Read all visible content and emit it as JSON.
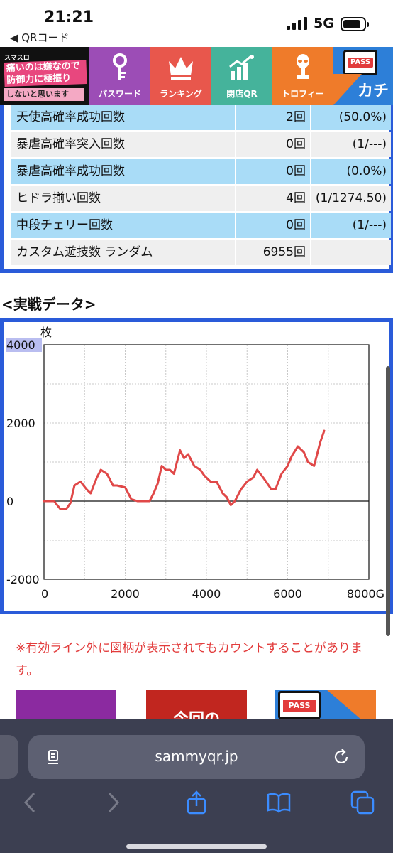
{
  "status_bar": {
    "time": "21:21",
    "back_label": "◀ QRコード",
    "network": "5G"
  },
  "nav": {
    "logo": {
      "line1": "スマスロ",
      "line2": "痛いのは嫌なので防御力に極振りしたいと思います",
      "line3": "しないと思います"
    },
    "tabs": [
      {
        "label": "パスワード",
        "icon": "key-icon",
        "color": "#9c4db6"
      },
      {
        "label": "ランキング",
        "icon": "crown-icon",
        "color": "#e8574c"
      },
      {
        "label": "閉店QR",
        "icon": "growth-chart-icon",
        "color": "#45b39b"
      },
      {
        "label": "トロフィー",
        "icon": "trophy-alien-icon",
        "color": "#ef7b2a"
      }
    ],
    "pass_badge": "PASS",
    "pass_text": "カチ"
  },
  "stats_table": {
    "rows": [
      {
        "label": "天使高確率成功回数",
        "count": "2回",
        "ratio": "(50.0%)",
        "style": "blue"
      },
      {
        "label": "暴虐高確率突入回数",
        "count": "0回",
        "ratio": "(1/---)",
        "style": "gray"
      },
      {
        "label": "暴虐高確率成功回数",
        "count": "0回",
        "ratio": "(0.0%)",
        "style": "blue"
      },
      {
        "label": "ヒドラ揃い回数",
        "count": "4回",
        "ratio": "(1/1274.50)",
        "style": "gray"
      },
      {
        "label": "中段チェリー回数",
        "count": "0回",
        "ratio": "(1/---)",
        "style": "blue"
      },
      {
        "label": "カスタム遊技数 ランダム",
        "count": "6955回",
        "ratio": "",
        "style": "gray"
      }
    ]
  },
  "section_title": "<実戦データ>",
  "chart_data": {
    "type": "line",
    "title": "",
    "ylabel": "枚",
    "xlabel": "G",
    "xlim": [
      0,
      8000
    ],
    "ylim": [
      -2000,
      4000
    ],
    "x_ticks": [
      "0",
      "2000",
      "4000",
      "6000",
      "8000G"
    ],
    "y_ticks": [
      "4000",
      "2000",
      "0",
      "-2000"
    ],
    "grid": true,
    "line_color": "#e04848",
    "series": [
      {
        "x": [
          0,
          250,
          400,
          550,
          650,
          750,
          900,
          1050,
          1150,
          1300,
          1400,
          1550,
          1700,
          1800,
          2000,
          2150,
          2300,
          2450,
          2600,
          2700,
          2800,
          2900,
          3000,
          3100,
          3200,
          3350,
          3450,
          3550,
          3700,
          3850,
          3950,
          4100,
          4250,
          4400,
          4500,
          4600,
          4700,
          4850,
          5000,
          5150,
          5250,
          5400,
          5500,
          5600,
          5700,
          5850,
          6000,
          6100,
          6250,
          6400,
          6500,
          6650,
          6800,
          6900
        ],
        "y": [
          0,
          0,
          -200,
          -200,
          -50,
          400,
          500,
          300,
          200,
          600,
          800,
          700,
          400,
          400,
          350,
          50,
          0,
          0,
          0,
          200,
          450,
          900,
          800,
          800,
          700,
          1300,
          1100,
          1200,
          900,
          800,
          650,
          500,
          500,
          200,
          100,
          -100,
          0,
          300,
          500,
          600,
          800,
          600,
          450,
          300,
          300,
          700,
          900,
          1150,
          1400,
          1250,
          1000,
          900,
          1500,
          1800
        ]
      }
    ]
  },
  "note": "※有効ライン外に図柄が表示されてもカウントすることがあります。",
  "banners": [
    {
      "label": ""
    },
    {
      "label": "今回の"
    },
    {
      "label": "PASS"
    }
  ],
  "safari": {
    "url": "sammyqr.jp"
  }
}
